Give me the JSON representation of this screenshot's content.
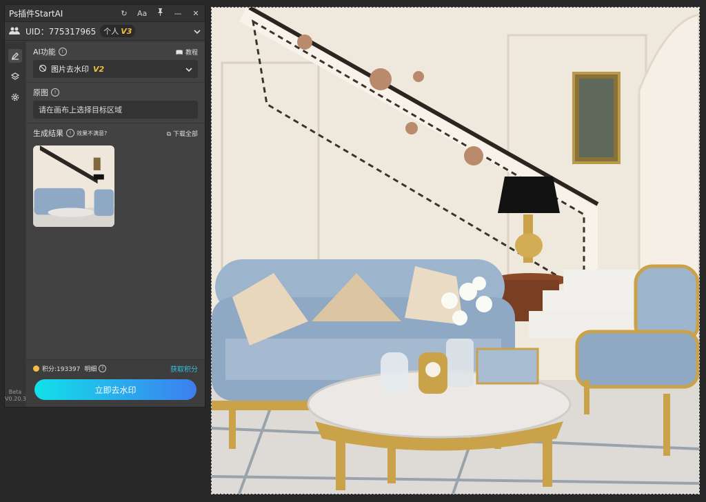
{
  "panel": {
    "title": "Ps插件StartAI",
    "controls": {
      "refresh": "↻",
      "font": "Aa",
      "pin": "📌",
      "minimize": "—",
      "close": "✕"
    },
    "user": {
      "uid": "UID：775317965",
      "tier": "个人",
      "tier_level": "V3"
    },
    "rail": {
      "version": "Beta V0.20.3"
    },
    "ai_section": {
      "label": "AI功能",
      "tutorial": "教程",
      "selected_feature": "图片去水印",
      "feature_version": "V2"
    },
    "original_section": {
      "label": "原图",
      "placeholder": "请在画布上选择目标区域"
    },
    "result_section": {
      "label": "生成结果",
      "feedback": "效果不满意?",
      "download_all": "下载全部"
    },
    "footer": {
      "points": "积分:193397",
      "detail": "明细",
      "get_points": "获取积分",
      "action": "立即去水印"
    }
  },
  "colors": {
    "accent_gradient_start": "#12e0e8",
    "accent_gradient_end": "#3d7ef0",
    "version_badge": "#f0c040",
    "link": "#2fc3e0"
  }
}
